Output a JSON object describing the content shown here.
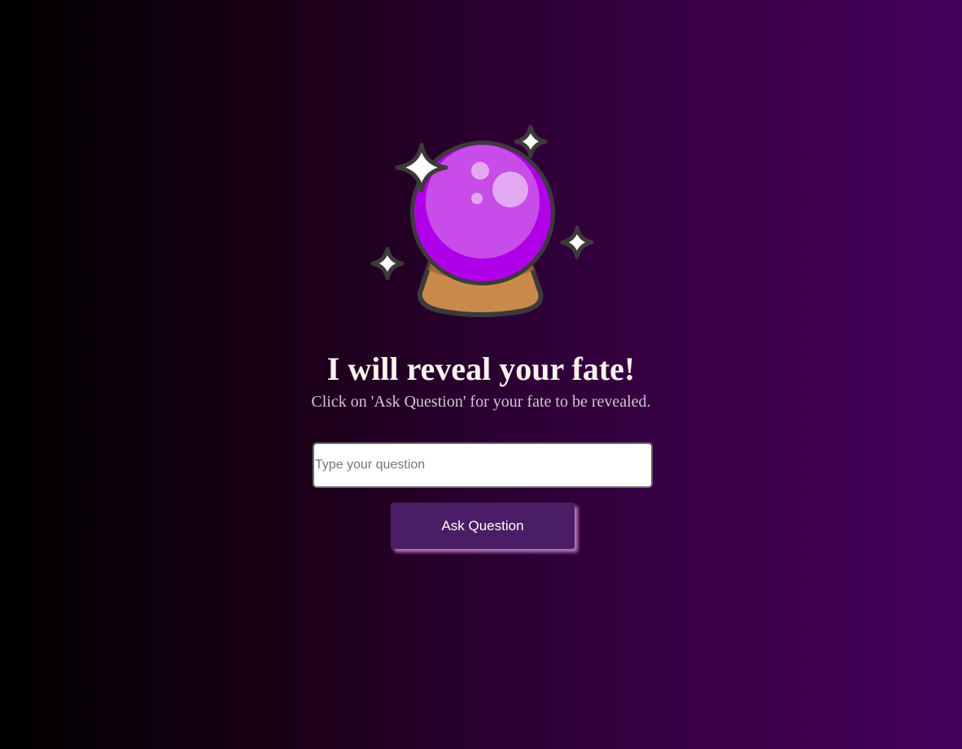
{
  "hero": {
    "icon": "crystal-ball-icon",
    "title": "I will reveal your fate!",
    "subtitle": "Click on 'Ask Question' for your fate to be revealed."
  },
  "form": {
    "question_placeholder": "Type your question",
    "question_value": "",
    "ask_button_label": "Ask Question"
  },
  "colors": {
    "background_start": "#000000",
    "background_end": "#44005a",
    "orb": "#b000e8",
    "orb_highlight": "#c84ce8",
    "base": "#c98a4c",
    "button": "#4a1d66",
    "button_shadow": "#e7a0ec"
  }
}
